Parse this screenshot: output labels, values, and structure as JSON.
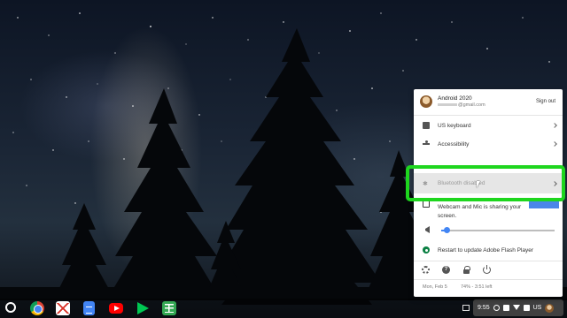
{
  "tray": {
    "user": {
      "name": "Android 2020",
      "email": "@gmail.com",
      "sign_out_label": "Sign out"
    },
    "items": [
      {
        "label": "US keyboard",
        "icon": "keyboard-icon"
      },
      {
        "label": "Accessibility",
        "icon": "accessibility-icon"
      },
      {
        "label": "Bluetooth disabled",
        "icon": "bluetooth-disabled-icon"
      }
    ],
    "webcam_notice": "Webcam and Mic is sharing your screen.",
    "volume": {
      "level": 0.05
    },
    "update_label": "Restart to update Adobe Flash Player",
    "bottom_icons": [
      "settings-icon",
      "help-icon",
      "lock-icon",
      "power-icon"
    ],
    "footer": {
      "date": "Mon, Feb 5",
      "battery": "74% - 3:51 left"
    }
  },
  "shelf": {
    "apps": [
      "chrome",
      "gmail",
      "docs",
      "youtube",
      "play-store",
      "sheets"
    ],
    "status": {
      "time": "9:55",
      "ime": "US"
    }
  },
  "colors": {
    "highlight": "#1ed61e",
    "accent": "#4285f4",
    "tray_bg": "#ffffff"
  }
}
